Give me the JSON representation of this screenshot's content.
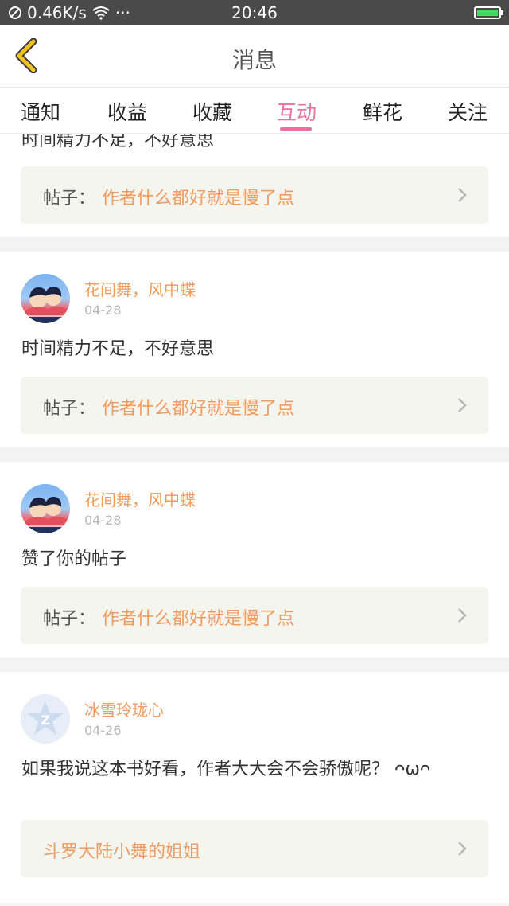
{
  "status_bar": {
    "network": "0.46K/s",
    "dots": "···",
    "time": "20:46"
  },
  "header": {
    "title": "消息"
  },
  "tabs": [
    {
      "label": "通知"
    },
    {
      "label": "收益"
    },
    {
      "label": "收藏"
    },
    {
      "label": "互动",
      "active": true
    },
    {
      "label": "鲜花"
    },
    {
      "label": "关注"
    }
  ],
  "cards": [
    {
      "message": "时间精力不足，不好意思",
      "post_label": "帖子：",
      "post_title": "作者什么都好就是慢了点"
    },
    {
      "author": "花间舞，风中蝶",
      "date": "04-28",
      "message": "时间精力不足，不好意思",
      "post_label": "帖子：",
      "post_title": "作者什么都好就是慢了点"
    },
    {
      "author": "花间舞，风中蝶",
      "date": "04-28",
      "message": "赞了你的帖子",
      "post_label": "帖子：",
      "post_title": "作者什么都好就是慢了点"
    },
    {
      "author": "冰雪玲珑心",
      "date": "04-26",
      "message": "如果我说这本书好看，作者大大会不会骄傲呢？ ᴖωᴖ",
      "post_title": "斗罗大陆小舞的姐姐"
    }
  ],
  "colors": {
    "accent_pink": "#e7729c",
    "author_orange": "#f09a5c",
    "back_yellow": "#f2c21b"
  }
}
